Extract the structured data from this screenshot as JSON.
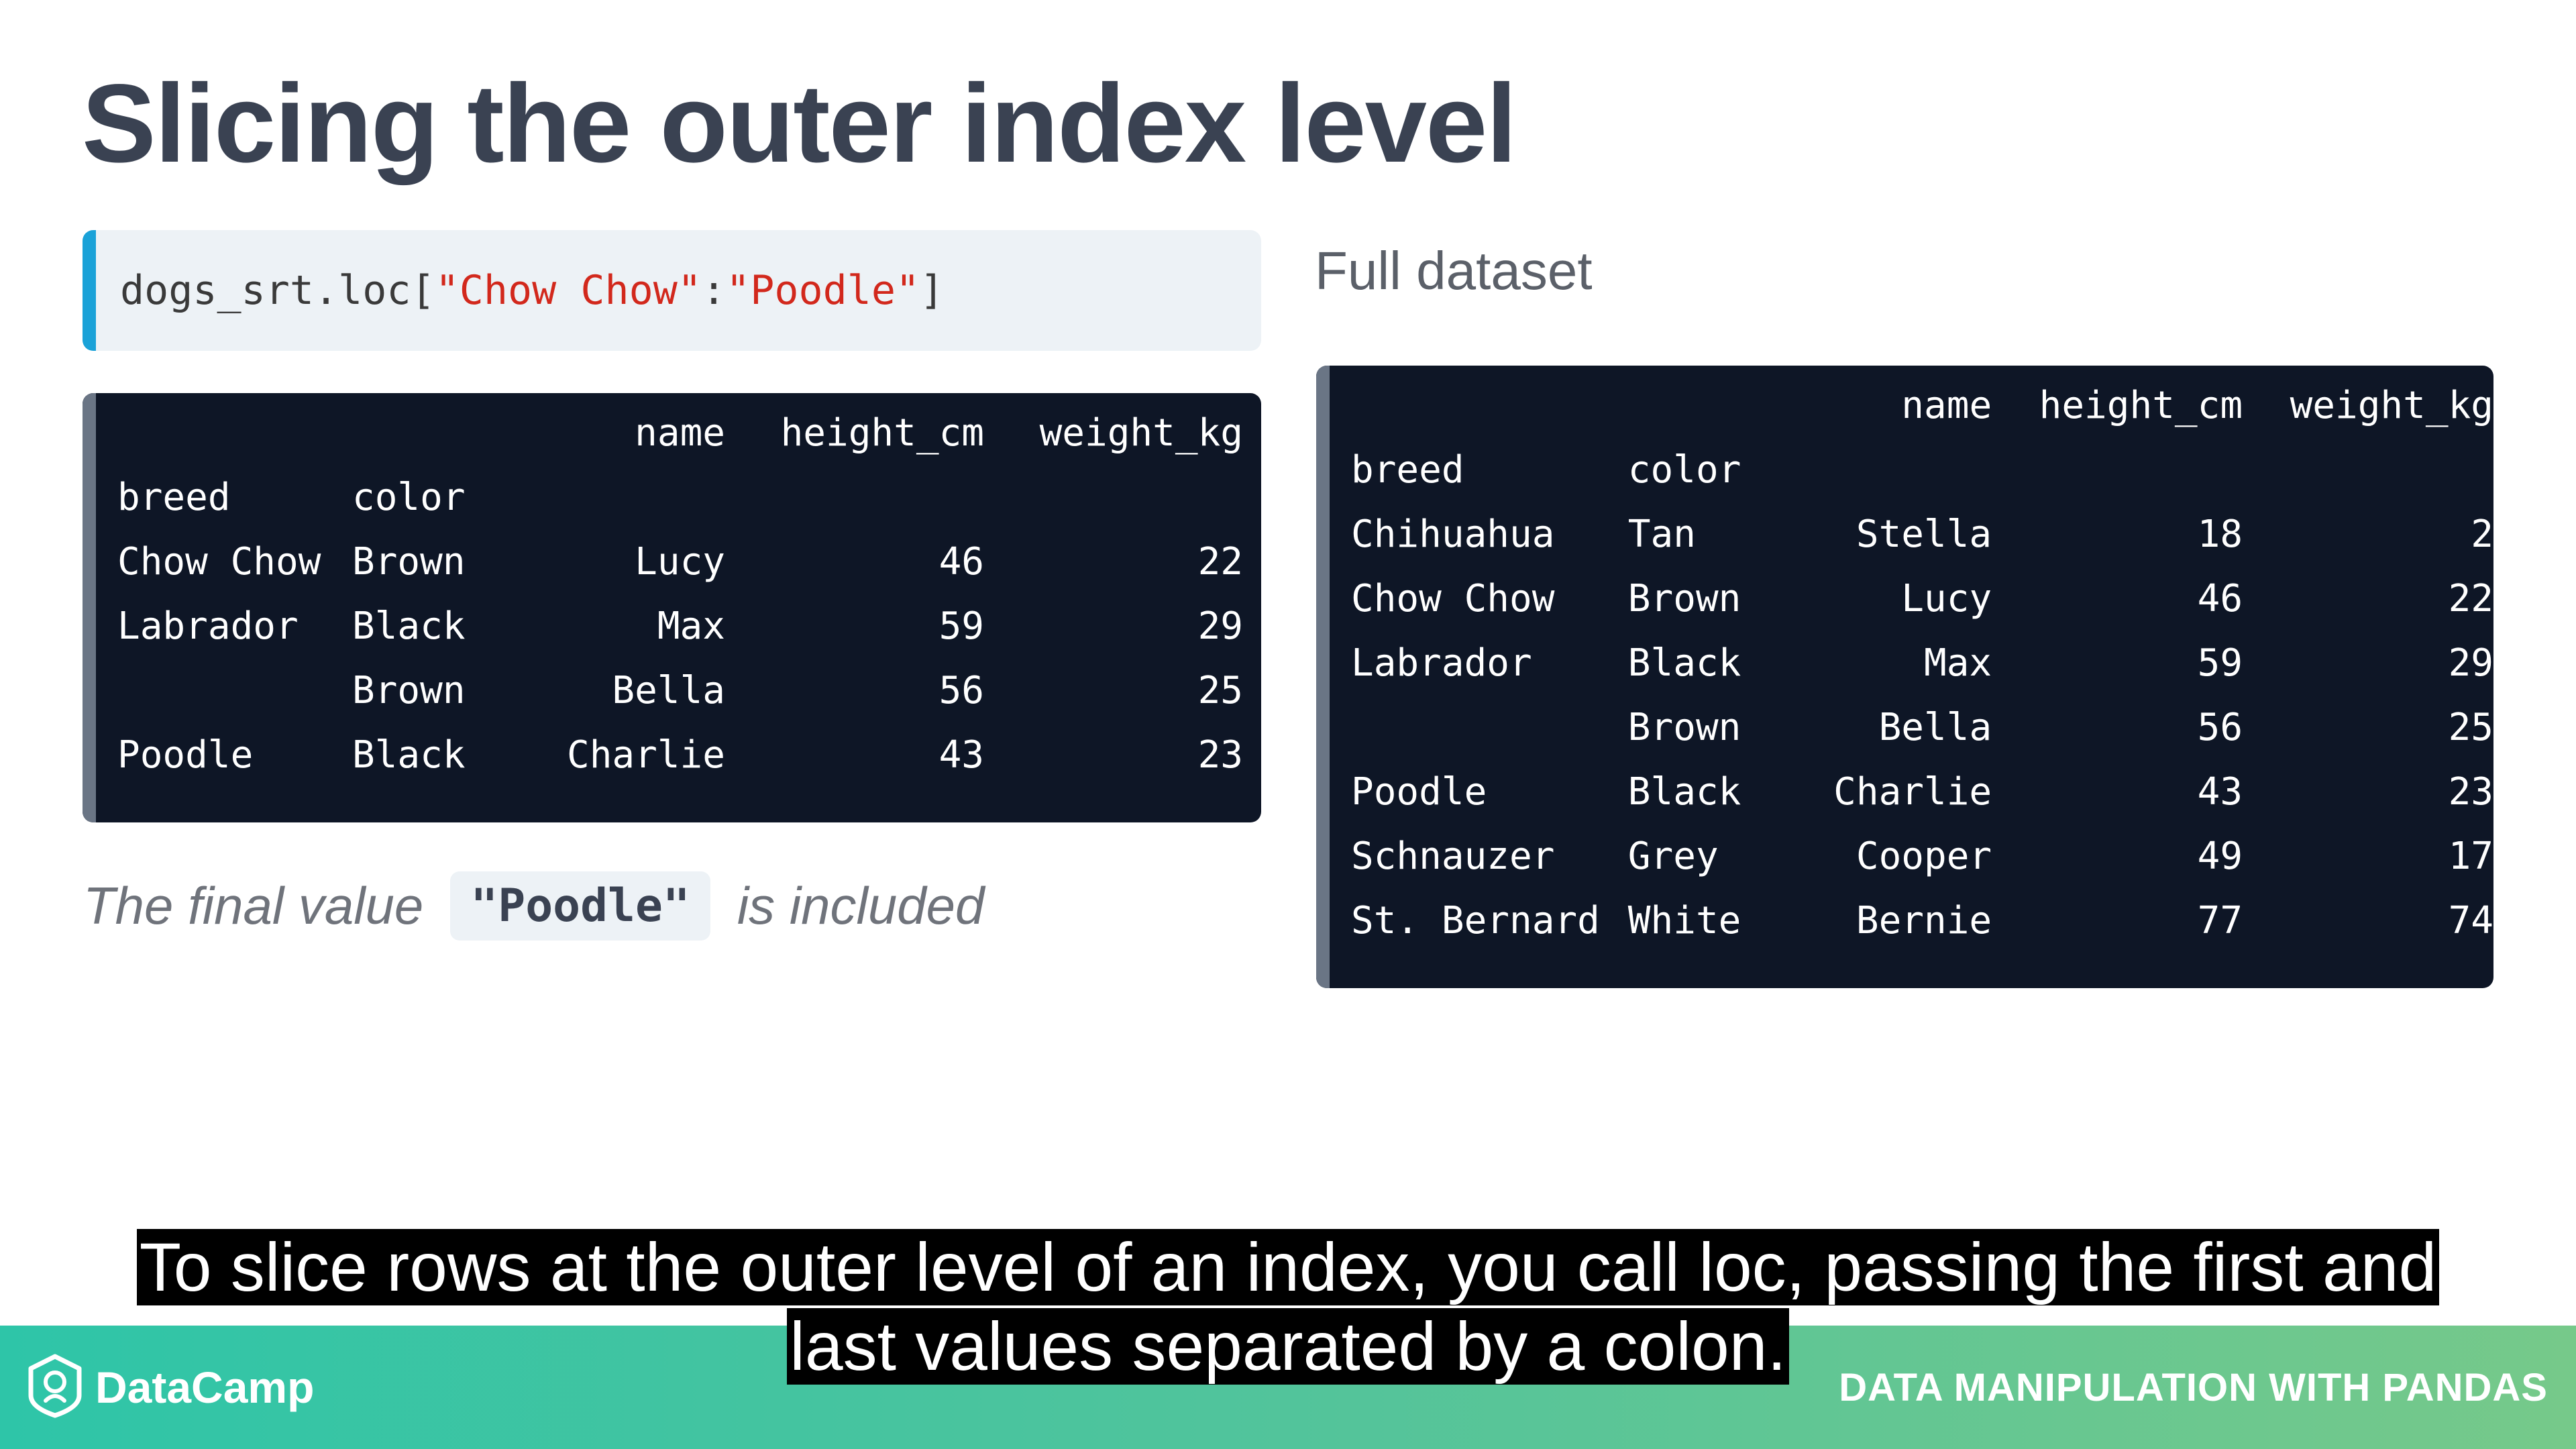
{
  "slide": {
    "title": "Slicing the outer index level",
    "code": {
      "prefix": "dogs_srt.loc[",
      "start": "\"Chow Chow\"",
      "sep": ":",
      "end": "\"Poodle\"",
      "suffix": "]"
    },
    "note": {
      "before": "The final value",
      "code": "\"Poodle\"",
      "after": "is included"
    },
    "full_dataset_label": "Full dataset"
  },
  "result_table": {
    "columns": [
      "name",
      "height_cm",
      "weight_kg"
    ],
    "index_names": [
      "breed",
      "color"
    ],
    "rows": [
      {
        "breed": "Chow Chow",
        "color": "Brown",
        "name": "Lucy",
        "height_cm": "46",
        "weight_kg": "22"
      },
      {
        "breed": "Labrador",
        "color": "Black",
        "name": "Max",
        "height_cm": "59",
        "weight_kg": "29"
      },
      {
        "breed": "",
        "color": "Brown",
        "name": "Bella",
        "height_cm": "56",
        "weight_kg": "25"
      },
      {
        "breed": "Poodle",
        "color": "Black",
        "name": "Charlie",
        "height_cm": "43",
        "weight_kg": "23"
      }
    ]
  },
  "full_table": {
    "columns": [
      "name",
      "height_cm",
      "weight_kg"
    ],
    "index_names": [
      "breed",
      "color"
    ],
    "rows": [
      {
        "breed": "Chihuahua",
        "color": "Tan",
        "name": "Stella",
        "height_cm": "18",
        "weight_kg": "2"
      },
      {
        "breed": "Chow Chow",
        "color": "Brown",
        "name": "Lucy",
        "height_cm": "46",
        "weight_kg": "22"
      },
      {
        "breed": "Labrador",
        "color": "Black",
        "name": "Max",
        "height_cm": "59",
        "weight_kg": "29"
      },
      {
        "breed": "",
        "color": "Brown",
        "name": "Bella",
        "height_cm": "56",
        "weight_kg": "25"
      },
      {
        "breed": "Poodle",
        "color": "Black",
        "name": "Charlie",
        "height_cm": "43",
        "weight_kg": "23"
      },
      {
        "breed": "Schnauzer",
        "color": "Grey",
        "name": "Cooper",
        "height_cm": "49",
        "weight_kg": "17"
      },
      {
        "breed": "St. Bernard",
        "color": "White",
        "name": "Bernie",
        "height_cm": "77",
        "weight_kg": "74"
      }
    ]
  },
  "caption": "To slice rows at the outer level of an index, you call loc, passing the first and last values separated by a colon.",
  "footer": {
    "brand": "DataCamp",
    "brand_icon": "datacamp-logo-icon",
    "course": "DATA MANIPULATION WITH PANDAS"
  },
  "colors": {
    "title": "#3a4252",
    "code_string": "#d2281c",
    "code_accent": "#1aa2d8",
    "terminal_bg": "#0e1626",
    "footer_gradient_start": "#2ec5a8",
    "footer_gradient_end": "#76c98a"
  }
}
